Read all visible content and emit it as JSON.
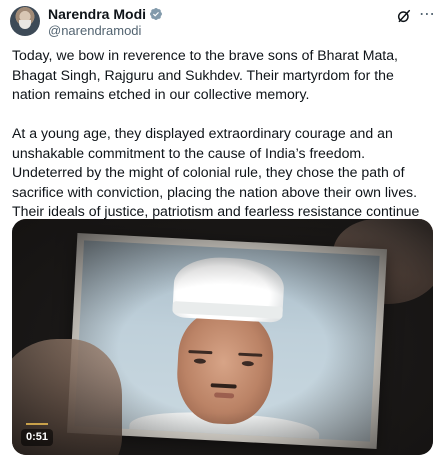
{
  "author": {
    "name": "Narendra Modi",
    "handle": "@narendramodi",
    "verified_icon": "verified-badge-icon"
  },
  "header_icons": {
    "grok": "grok-icon",
    "more": "more-options-icon",
    "more_glyph": "⋯"
  },
  "post": {
    "paragraphs": [
      "Today, we bow in reverence to the brave sons of Bharat Mata, Bhagat Singh, Rajguru and Sukhdev. Their martyrdom for the nation remains etched in our collective memory.",
      "At a young age, they displayed extraordinary courage and an unshakable commitment to the cause of India’s freedom. Undeterred by the might of colonial rule, they chose the path of sacrifice with conviction, placing the nation above their own lives. Their ideals of justice, patriotism and fearless resistance continue to ignite the spirit of countless Indians."
    ]
  },
  "media": {
    "type": "video",
    "duration": "0:51",
    "thumbnail_subject": "portrait-photograph"
  },
  "colors": {
    "text": "#0f1419",
    "secondary": "#536471",
    "verified": "#1d9bf0"
  }
}
